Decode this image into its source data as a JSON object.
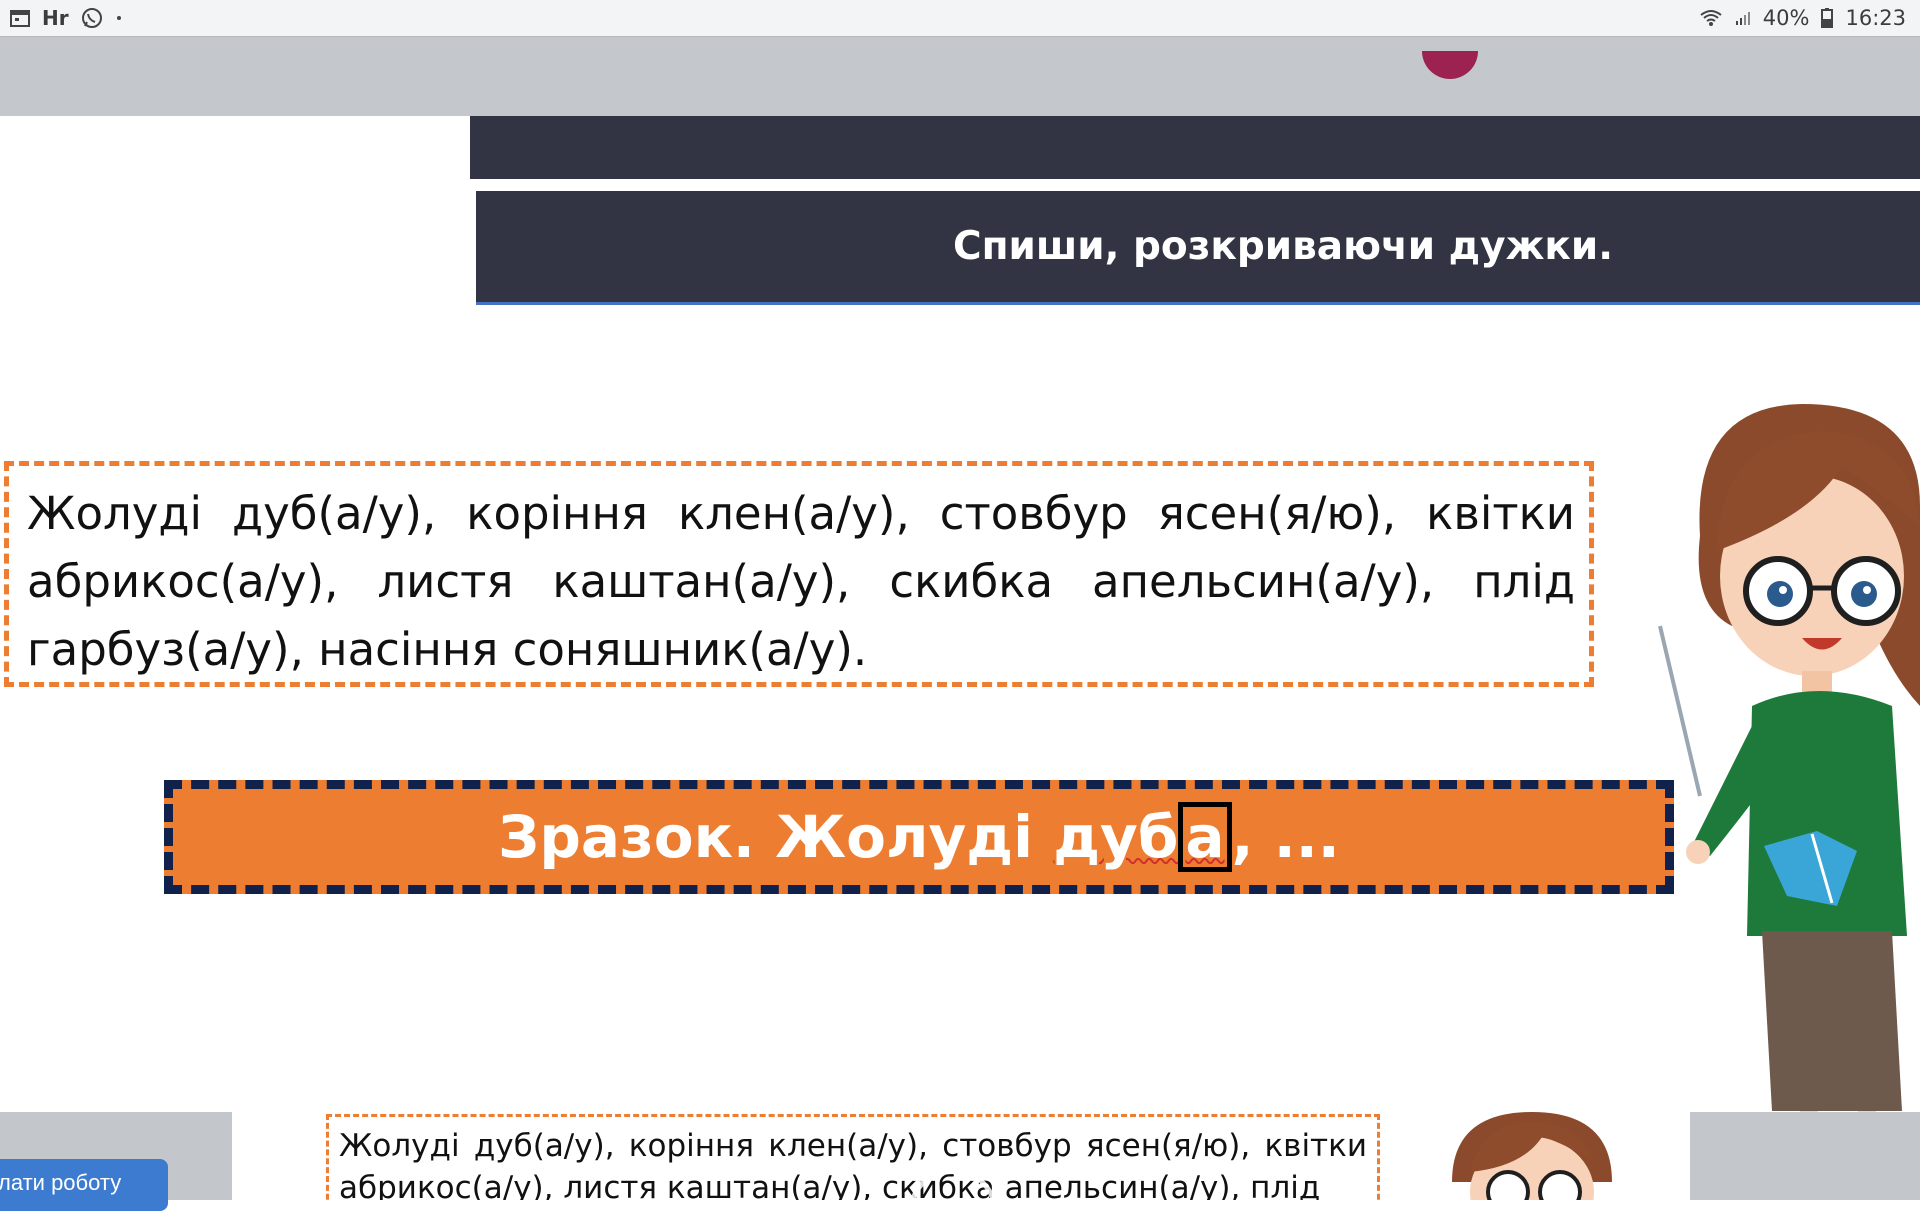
{
  "status_bar": {
    "left_icons": [
      "calendar-icon",
      "hr-app-icon",
      "viber-icon",
      "dot-icon"
    ],
    "hr_label": "Hr",
    "battery_percent": "40%",
    "time": "16:23"
  },
  "slide": {
    "title": "Спиши, розкриваючи дужки.",
    "exercise_text": "Жолуді дуб(а/у), коріння клен(а/у), стовбур ясен(я/ю), квітки абрикос(а/у), листя каштан(а/у), скибка апельсин(а/у), плід гарбуз(а/у), насіння соняшник(а/у).",
    "sample": {
      "prefix": "Зразок. Жолуді ",
      "word_stem_underlined": "дуб",
      "highlighted_letter": "а",
      "suffix": ", ..."
    }
  },
  "bottom_preview": {
    "exercise_text": "Жолуді дуб(а/у), коріння клен(а/у), стовбур ясен(я/ю), квітки абрикос(а/у), листя каштан(а/у), скибка апельсин(а/у), плід"
  },
  "send_button_label": "лати роботу",
  "colors": {
    "banner": "#323443",
    "orange": "#ed7d31",
    "dash_navy": "#10214b",
    "button_blue": "#3c7bd0"
  }
}
